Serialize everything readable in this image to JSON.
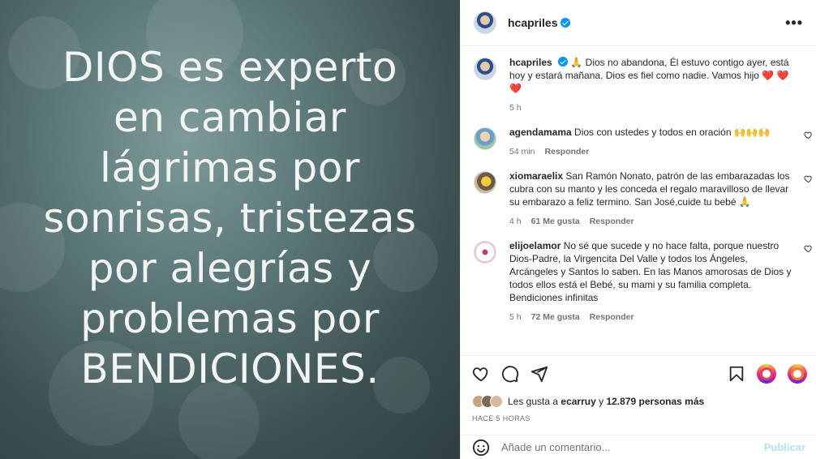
{
  "media": {
    "lines": [
      "DIOS es experto",
      "en cambiar",
      "lágrimas por",
      "sonrisas, tristezas",
      "por alegrías y",
      "problemas por",
      "BENDICIONES."
    ]
  },
  "post": {
    "username": "hcapriles",
    "more_label": "•••"
  },
  "caption": {
    "username": "hcapriles",
    "text": "🙏 Dios no abandona, Él estuvo contigo ayer, está hoy y estará mañana. Dios es fiel como nadie. Vamos hijo ❤️ ❤️ ❤️",
    "time": "5 h"
  },
  "comments": [
    {
      "username": "agendamama",
      "text": "Dios con ustedes y todos en oración 🙌🙌🙌",
      "time": "54 min",
      "likes": "",
      "reply": "Responder"
    },
    {
      "username": "xiomaraelix",
      "text": "San Ramón Nonato, patrón de las embarazadas los cubra con su manto y les conceda el regalo maravilloso de llevar su embarazo a feliz termino. San José,cuide tu bebé 🙏",
      "time": "4 h",
      "likes": "61 Me gusta",
      "reply": "Responder"
    },
    {
      "username": "elijoelamor",
      "text": "No sé que sucede y no hace falta, porque nuestro Dios-Padre, la Virgencita Del Valle y todos los Ángeles, Arcángeles y Santos lo saben. En las Manos amorosas de Dios y todos ellos está el Bebé, su mami y su familia completa. Bendiciones infinitas",
      "time": "5 h",
      "likes": "72 Me gusta",
      "reply": "Responder"
    }
  ],
  "likes": {
    "prefix": "Les gusta a",
    "user": "ecarruy",
    "middle": "y",
    "count": "12.879 personas más"
  },
  "timestamp": "HACE 5 HORAS",
  "add_comment": {
    "placeholder": "Añade un comentario...",
    "publish": "Publicar"
  },
  "colors": {
    "accent": "#0095f6",
    "like": "#ed4956",
    "publish_disabled": "#b2dffc"
  },
  "icons": [
    "heart-icon",
    "comment-icon",
    "share-icon",
    "bookmark-icon",
    "emoji-icon",
    "verified-icon"
  ]
}
